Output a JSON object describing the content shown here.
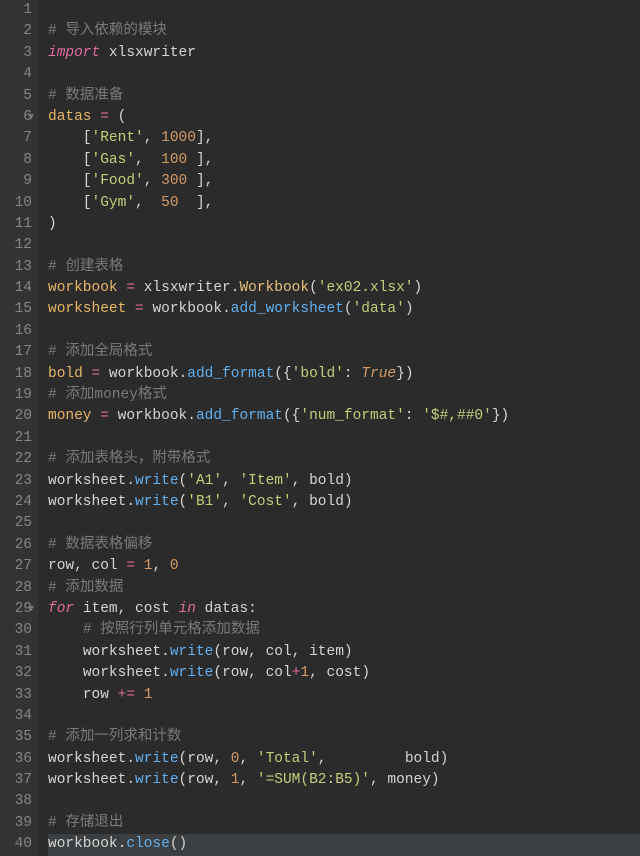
{
  "lines": {
    "1": "",
    "2": {
      "comment": "# 导入依赖的模块"
    },
    "3": {
      "kw": "import",
      "mod": "xlsxwriter"
    },
    "4": "",
    "5": {
      "comment": "# 数据准备"
    },
    "6": {
      "var": "datas",
      "op": "=",
      "p": "("
    },
    "7": {
      "indent": "    ",
      "lb": "[",
      "s": "'Rent'",
      "comma": ",",
      "sp": " ",
      "n": "1000",
      "rb": "]",
      "c2": ","
    },
    "8": {
      "indent": "    ",
      "lb": "[",
      "s": "'Gas'",
      "comma": ",",
      "sp": "  ",
      "n": "100",
      "sp2": " ",
      "rb": "]",
      "c2": ","
    },
    "9": {
      "indent": "    ",
      "lb": "[",
      "s": "'Food'",
      "comma": ",",
      "sp": " ",
      "n": "300",
      "sp2": " ",
      "rb": "]",
      "c2": ","
    },
    "10": {
      "indent": "    ",
      "lb": "[",
      "s": "'Gym'",
      "comma": ",",
      "sp": "  ",
      "n": "50",
      "sp2": "  ",
      "rb": "]",
      "c2": ","
    },
    "11": {
      "p": ")"
    },
    "12": "",
    "13": {
      "comment": "# 创建表格"
    },
    "14": {
      "var": "workbook",
      "op": "=",
      "mod": "xlsxwriter",
      "dot": ".",
      "cls": "Workbook",
      "lp": "(",
      "s": "'ex02.xlsx'",
      "rp": ")"
    },
    "15": {
      "var": "worksheet",
      "op": "=",
      "obj": "workbook",
      "dot": ".",
      "fn": "add_worksheet",
      "lp": "(",
      "s": "'data'",
      "rp": ")"
    },
    "16": "",
    "17": {
      "comment": "# 添加全局格式"
    },
    "18": {
      "var": "bold",
      "op": "=",
      "obj": "workbook",
      "dot": ".",
      "fn": "add_format",
      "lp": "(",
      "lb": "{",
      "s": "'bold'",
      "colon": ":",
      "sp": " ",
      "b": "True",
      "rb": "}",
      "rp": ")"
    },
    "19": {
      "comment": "# 添加money格式"
    },
    "20": {
      "var": "money",
      "op": "=",
      "obj": "workbook",
      "dot": ".",
      "fn": "add_format",
      "lp": "(",
      "lb": "{",
      "s": "'num_format'",
      "colon": ":",
      "sp": " ",
      "s2": "'$#,##0'",
      "rb": "}",
      "rp": ")"
    },
    "21": "",
    "22": {
      "comment": "# 添加表格头，附带格式"
    },
    "23": {
      "obj": "worksheet",
      "dot": ".",
      "fn": "write",
      "lp": "(",
      "s": "'A1'",
      "c1": ",",
      "sp": " ",
      "s2": "'Item'",
      "c2": ",",
      "sp2": " ",
      "arg": "bold",
      "rp": ")"
    },
    "24": {
      "obj": "worksheet",
      "dot": ".",
      "fn": "write",
      "lp": "(",
      "s": "'B1'",
      "c1": ",",
      "sp": " ",
      "s2": "'Cost'",
      "c2": ",",
      "sp2": " ",
      "arg": "bold",
      "rp": ")"
    },
    "25": "",
    "26": {
      "comment": "# 数据表格偏移"
    },
    "27": {
      "v1": "row",
      "c1": ",",
      "sp": " ",
      "v2": "col",
      "op": "=",
      "n1": "1",
      "c2": ",",
      "sp2": " ",
      "n2": "0"
    },
    "28": {
      "comment": "# 添加数据"
    },
    "29": {
      "kw1": "for",
      "sp1": " ",
      "v1": "item",
      "c1": ",",
      "sp2": " ",
      "v2": "cost",
      "sp3": " ",
      "kw2": "in",
      "sp4": " ",
      "it": "datas",
      "colon": ":"
    },
    "30": {
      "indent": "    ",
      "comment": "# 按照行列单元格添加数据"
    },
    "31": {
      "indent": "    ",
      "obj": "worksheet",
      "dot": ".",
      "fn": "write",
      "lp": "(",
      "a1": "row",
      "c1": ",",
      "sp": " ",
      "a2": "col",
      "c2": ",",
      "sp2": " ",
      "a3": "item",
      "rp": ")"
    },
    "32": {
      "indent": "    ",
      "obj": "worksheet",
      "dot": ".",
      "fn": "write",
      "lp": "(",
      "a1": "row",
      "c1": ",",
      "sp": " ",
      "a2": "col",
      "op": "+",
      "n": "1",
      "c2": ",",
      "sp2": " ",
      "a3": "cost",
      "rp": ")"
    },
    "33": {
      "indent": "    ",
      "v": "row",
      "sp": " ",
      "op": "+=",
      "sp2": " ",
      "n": "1"
    },
    "34": "",
    "35": {
      "comment": "# 添加一列求和计数"
    },
    "36": {
      "obj": "worksheet",
      "dot": ".",
      "fn": "write",
      "lp": "(",
      "a1": "row",
      "c1": ",",
      "sp": " ",
      "n": "0",
      "c2": ",",
      "sp2": " ",
      "s": "'Total'",
      "c3": ",",
      "sp3": "         ",
      "arg": "bold",
      "rp": ")"
    },
    "37": {
      "obj": "worksheet",
      "dot": ".",
      "fn": "write",
      "lp": "(",
      "a1": "row",
      "c1": ",",
      "sp": " ",
      "n": "1",
      "c2": ",",
      "sp2": " ",
      "s": "'=SUM(B2:B5)'",
      "c3": ",",
      "sp3": " ",
      "arg": "money",
      "rp": ")"
    },
    "38": "",
    "39": {
      "comment": "# 存储退出"
    },
    "40": {
      "obj": "workbook",
      "dot": ".",
      "fn": "close",
      "lp": "(",
      "rp": ")"
    }
  },
  "fold_lines": [
    6,
    29
  ],
  "highlight_line": 40,
  "total_lines": 40
}
